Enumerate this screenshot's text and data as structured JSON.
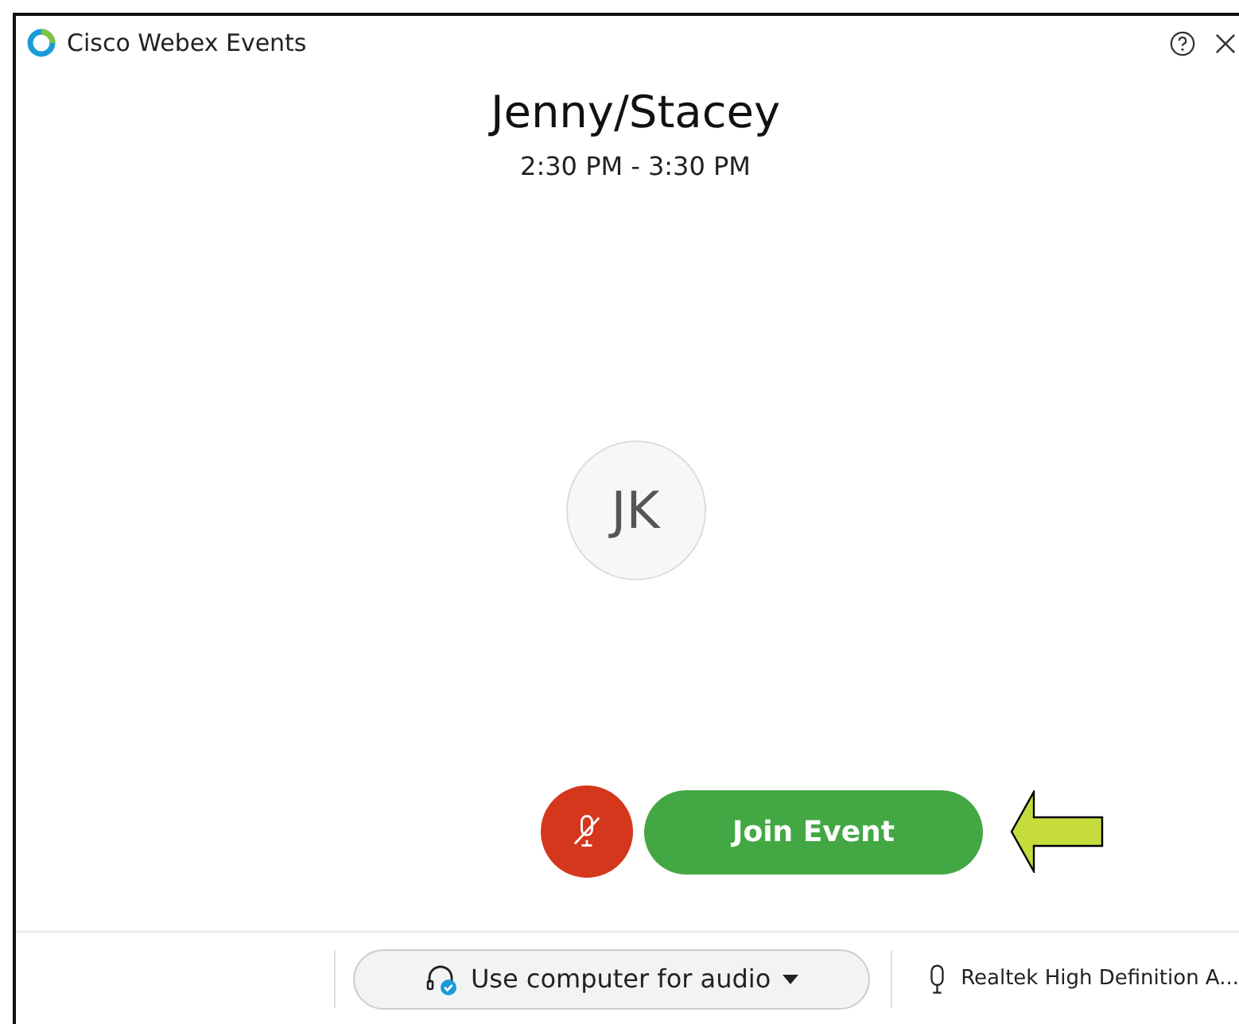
{
  "window": {
    "title": "Cisco Webex Events"
  },
  "meeting": {
    "title": "Jenny/Stacey",
    "time": "2:30 PM - 3:30 PM",
    "avatar_initials": "JK"
  },
  "mute_button": {
    "muted": true
  },
  "join_button": {
    "label": "Join Event"
  },
  "audio": {
    "option": "Use computer for audio",
    "device": "Realtek High Definition A..."
  }
}
